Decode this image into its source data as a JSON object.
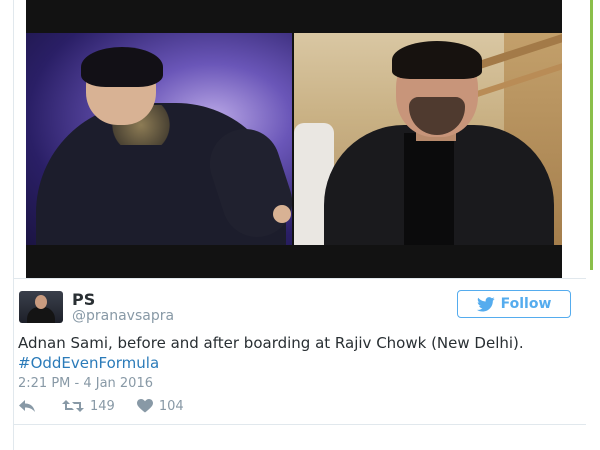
{
  "media": {
    "photo_left": "before-photo",
    "photo_right": "after-photo"
  },
  "user": {
    "display_name": "PS",
    "handle": "@pranavsapra"
  },
  "follow": {
    "label": "Follow"
  },
  "tweet": {
    "text_main": "Adnan Sami, before and after boarding at Rajiv Chowk (New Delhi).",
    "hashtag": "#OddEvenFormula",
    "timestamp": "2:21 PM - 4 Jan 2016"
  },
  "stats": {
    "retweets": "149",
    "likes": "104"
  },
  "colors": {
    "accent": "#55acee",
    "hashtag": "#2b7bb9",
    "muted": "#8899a6",
    "text": "#292f33"
  },
  "icons": [
    "bird-icon",
    "reply-icon",
    "retweet-icon",
    "heart-icon"
  ]
}
